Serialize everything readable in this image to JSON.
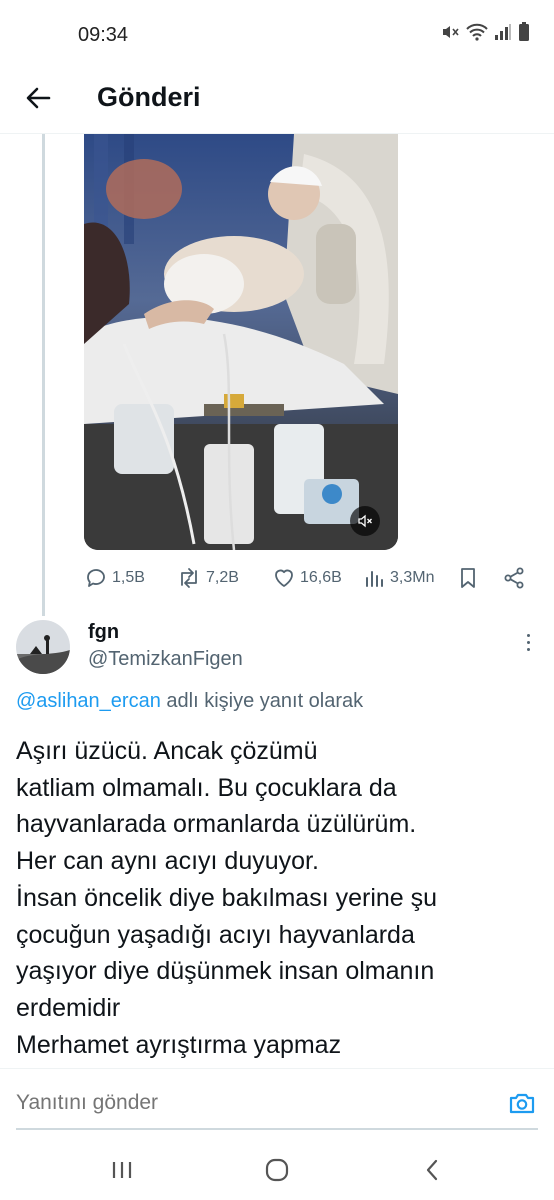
{
  "status_bar": {
    "time": "09:34",
    "icons": [
      "mute-icon",
      "wifi-icon",
      "signal-icon",
      "battery-icon"
    ]
  },
  "header": {
    "title": "Gönderi",
    "back_icon": "arrow-left-icon"
  },
  "media": {
    "type": "video",
    "mute_icon": "volume-mute-icon"
  },
  "actions": {
    "replies": "1,5B",
    "retweets": "7,2B",
    "likes": "16,6B",
    "views": "3,3Mn",
    "bookmark_icon": "bookmark-icon",
    "share_icon": "share-icon"
  },
  "reply": {
    "name": "fgn",
    "handle": "@TemizkanFigen",
    "reply_to_mention": "@aslihan_ercan",
    "reply_to_suffix": " adlı kişiye yanıt olarak",
    "lines": [
      "Aşırı üzücü.  Ancak çözümü",
      "katliam olmamalı. Bu çocuklara da",
      "hayvanlarada ormanlarda üzülürüm.",
      "Her can aynı acıyı  duyuyor.",
      "İnsan öncelik  diye bakılması  yerine şu",
      "çocuğun yaşadığı  acıyı  hayvanlarda",
      "yaşıyor  diye düşünmek  insan olmanın",
      "erdemidir",
      "Merhamet ayrıştırma yapmaz"
    ]
  },
  "compose": {
    "placeholder": "Yanıtını gönder",
    "camera_icon": "camera-icon"
  },
  "navbar": {
    "icons": [
      "recent-apps-icon",
      "home-icon",
      "back-icon"
    ]
  },
  "colors": {
    "accent": "#1d9bf0",
    "text_primary": "#0f1419",
    "text_secondary": "#536471",
    "thread_line": "#cfd9de"
  }
}
